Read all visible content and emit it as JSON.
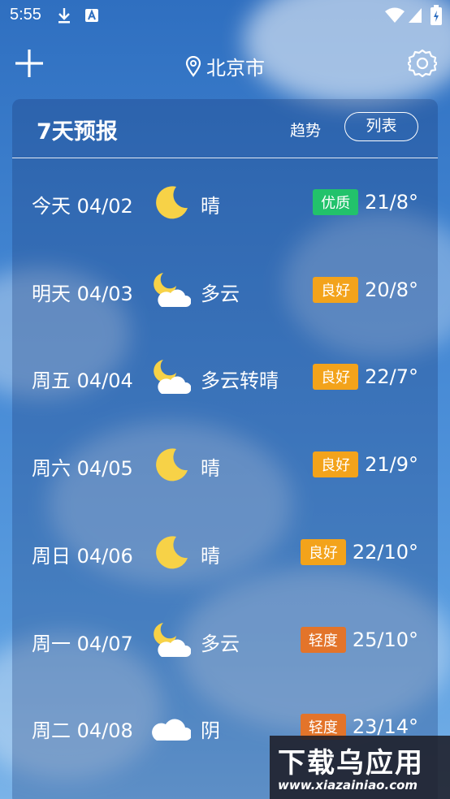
{
  "status": {
    "time": "5:55"
  },
  "header": {
    "city": "北京市"
  },
  "forecast": {
    "title": "7天预报",
    "tab_trend": "趋势",
    "tab_list": "列表",
    "days": [
      {
        "day": "今天 04/02",
        "icon": "moon-icon",
        "desc": "晴",
        "aqi": "优质",
        "aqi_color": "#22c26b",
        "temp": "21/8°"
      },
      {
        "day": "明天 04/03",
        "icon": "moon-cloud-icon",
        "desc": "多云",
        "aqi": "良好",
        "aqi_color": "#f3a31b",
        "temp": "20/8°"
      },
      {
        "day": "周五 04/04",
        "icon": "moon-cloud-icon",
        "desc": "多云转晴",
        "aqi": "良好",
        "aqi_color": "#f3a31b",
        "temp": "22/7°"
      },
      {
        "day": "周六 04/05",
        "icon": "moon-icon",
        "desc": "晴",
        "aqi": "良好",
        "aqi_color": "#f3a31b",
        "temp": "21/9°"
      },
      {
        "day": "周日 04/06",
        "icon": "moon-icon",
        "desc": "晴",
        "aqi": "良好",
        "aqi_color": "#f3a31b",
        "temp": "22/10°"
      },
      {
        "day": "周一 04/07",
        "icon": "moon-cloud-icon",
        "desc": "多云",
        "aqi": "轻度",
        "aqi_color": "#e3742a",
        "temp": "25/10°"
      },
      {
        "day": "周二 04/08",
        "icon": "cloud-icon",
        "desc": "阴",
        "aqi": "轻度",
        "aqi_color": "#e3742a",
        "temp": "23/14°"
      }
    ]
  },
  "watermark": {
    "title": "下载乌应用",
    "url": "www.xiazainiao.com"
  }
}
